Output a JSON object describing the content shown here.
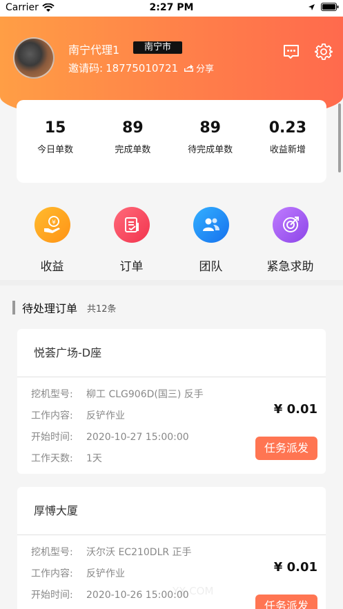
{
  "status": {
    "carrier": "Carrier",
    "time": "2:27 PM"
  },
  "profile": {
    "name": "南宁代理1",
    "city": "南宁市",
    "invite_label": "邀请码:",
    "invite_code": "18775010721",
    "share_label": "分享"
  },
  "stats": [
    {
      "value": "15",
      "label": "今日单数"
    },
    {
      "value": "89",
      "label": "完成单数"
    },
    {
      "value": "89",
      "label": "待完成单数"
    },
    {
      "value": "0.23",
      "label": "收益新增"
    }
  ],
  "actions": [
    {
      "label": "收益",
      "icon": "earnings-icon",
      "color": "#ffa21e"
    },
    {
      "label": "订单",
      "icon": "order-icon",
      "color": "#f8495f"
    },
    {
      "label": "团队",
      "icon": "team-icon",
      "color": "#1c8ff5"
    },
    {
      "label": "紧急求助",
      "icon": "emergency-icon",
      "color": "#a35cf0"
    }
  ],
  "section": {
    "title": "待处理订单",
    "count": "共12条"
  },
  "orders": [
    {
      "title": "悦荟广场-D座",
      "rows": [
        {
          "label": "挖机型号:",
          "value": "柳工 CLG906D(国三) 反手"
        },
        {
          "label": "工作内容:",
          "value": "反铲作业"
        },
        {
          "label": "开始时间:",
          "value": "2020-10-27 15:00:00"
        },
        {
          "label": "工作天数:",
          "value": "1天"
        }
      ],
      "price": "¥ 0.01",
      "button": "任务派发"
    },
    {
      "title": "厚愽大厦",
      "rows": [
        {
          "label": "挖机型号:",
          "value": "沃尔沃 EC210DLR 正手"
        },
        {
          "label": "工作内容:",
          "value": "反铲作业"
        },
        {
          "label": "开始时间:",
          "value": "2020-10-26 15:00:00"
        }
      ],
      "price": "¥ 0.01",
      "button": "任务派发"
    }
  ],
  "watermark": "YX.COM",
  "colors": {
    "accent": "#ff7552",
    "header_start": "#ff9e45",
    "header_end": "#ff6a4d"
  }
}
